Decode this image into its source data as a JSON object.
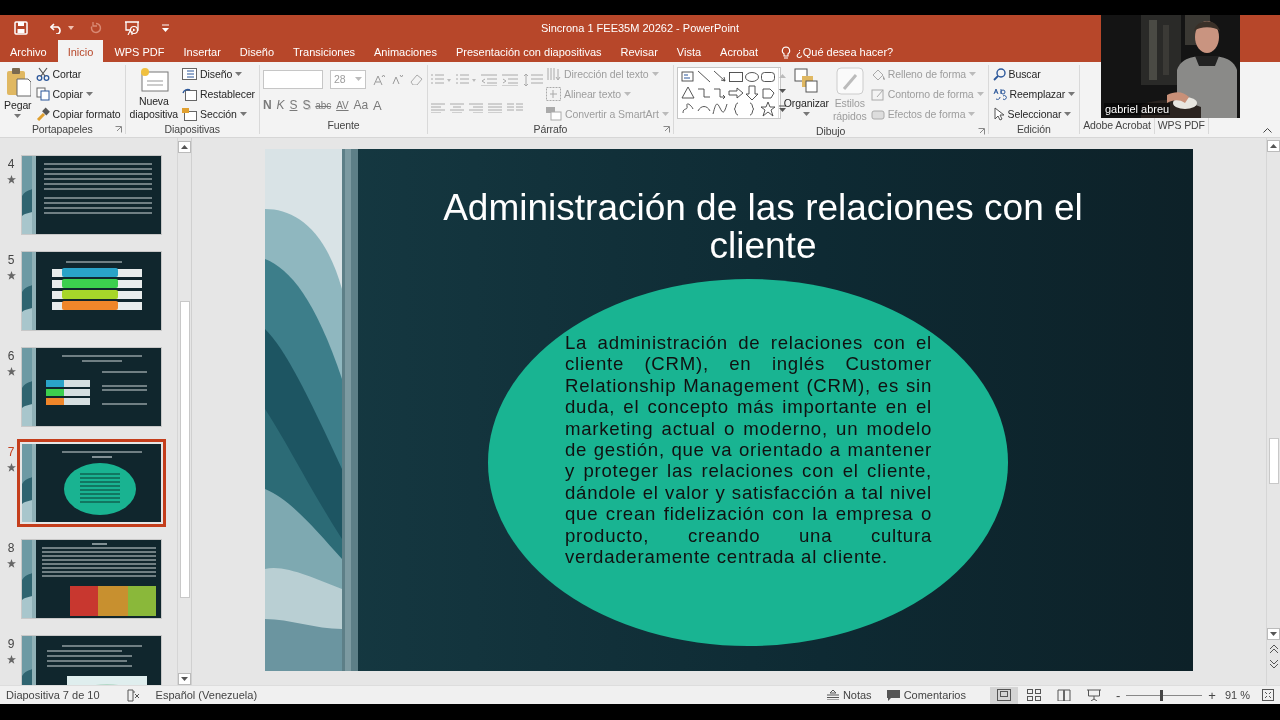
{
  "window": {
    "title": "Sincrona 1 FEE35M 20262 - PowerPoint"
  },
  "tabs": [
    {
      "label": "Archivo",
      "selected": false
    },
    {
      "label": "Inicio",
      "selected": true
    },
    {
      "label": "WPS PDF",
      "selected": false
    },
    {
      "label": "Insertar",
      "selected": false
    },
    {
      "label": "Diseño",
      "selected": false
    },
    {
      "label": "Transiciones",
      "selected": false
    },
    {
      "label": "Animaciones",
      "selected": false
    },
    {
      "label": "Presentación con diapositivas",
      "selected": false
    },
    {
      "label": "Revisar",
      "selected": false
    },
    {
      "label": "Vista",
      "selected": false
    },
    {
      "label": "Acrobat",
      "selected": false
    }
  ],
  "tell_me": "¿Qué desea hacer?",
  "ribbon": {
    "groups": [
      {
        "kind": "clipboard",
        "label": "Portapapeles",
        "items": [
          {
            "label": "Pegar"
          },
          {
            "label": "Cortar"
          },
          {
            "label": "Copiar"
          },
          {
            "label": "Copiar formato"
          }
        ]
      },
      {
        "kind": "slides",
        "label": "Diapositivas",
        "items": [
          {
            "label": "Nueva diapositiva"
          },
          {
            "label": "Diseño"
          },
          {
            "label": "Restablecer"
          },
          {
            "label": "Sección"
          }
        ]
      },
      {
        "kind": "font",
        "label": "Fuente",
        "font_size": "28",
        "format_buttons": [
          {
            "kind": "bold",
            "label": "N"
          },
          {
            "kind": "italic",
            "label": "K"
          },
          {
            "kind": "underline",
            "label": "S"
          },
          {
            "kind": "shadow",
            "label": "S"
          },
          {
            "kind": "strike",
            "label": "abc"
          },
          {
            "kind": "spacing",
            "label": "AV"
          },
          {
            "kind": "case",
            "label": "Aa"
          },
          {
            "kind": "color",
            "label": "A"
          }
        ]
      },
      {
        "kind": "paragraph",
        "label": "Párrafo",
        "items": [
          {
            "label": "Dirección del texto",
            "disabled": true
          },
          {
            "label": "Alinear texto",
            "disabled": true
          },
          {
            "label": "Convertir a SmartArt",
            "disabled": true
          }
        ]
      },
      {
        "kind": "drawing",
        "label": "Dibujo",
        "items": [
          {
            "label": "Organizar",
            "disabled": false
          },
          {
            "label": "Estilos rápidos",
            "disabled": true
          },
          {
            "label": "Relleno de forma",
            "disabled": true
          },
          {
            "label": "Contorno de forma",
            "disabled": true
          },
          {
            "label": "Efectos de forma",
            "disabled": true
          }
        ]
      },
      {
        "kind": "editing",
        "label": "Edición",
        "items": [
          {
            "label": "Buscar"
          },
          {
            "label": "Reemplazar"
          },
          {
            "label": "Seleccionar"
          }
        ]
      },
      {
        "kind": "plain",
        "label": "Adobe Acrobat"
      },
      {
        "kind": "plain",
        "label": "WPS PDF"
      }
    ]
  },
  "slide_panel": {
    "thumbnails": [
      {
        "number": "4",
        "selected": false
      },
      {
        "number": "5",
        "selected": false
      },
      {
        "number": "6",
        "selected": false
      },
      {
        "number": "7",
        "selected": true
      },
      {
        "number": "8",
        "selected": false
      },
      {
        "number": "9",
        "selected": false
      }
    ]
  },
  "slide": {
    "title": "Administración de las relaciones con el cliente",
    "body": "La administración de relaciones con el cliente (CRM), en inglés Customer Relationship Management (CRM), es sin duda, el concepto más importante en el marketing actual o moderno, un modelo de gestión, que va orientado a mantener y proteger las relaciones con el cliente, dándole el valor y satisfacción a tal nivel que crean fidelización con la empresa o producto, creando una cultura verdaderamente centrada al cliente."
  },
  "webcam": {
    "name": "gabriel abreu"
  },
  "status_bar": {
    "slide_info": "Diapositiva 7 de 10",
    "language": "Español (Venezuela)",
    "notes": "Notas",
    "comments": "Comentarios",
    "views": [
      {
        "kind": "normal",
        "selected": true
      },
      {
        "kind": "sorter",
        "selected": false
      },
      {
        "kind": "reading",
        "selected": false
      },
      {
        "kind": "slideshow",
        "selected": false
      }
    ],
    "zoom": {
      "out": "-",
      "in": "+",
      "level": 0.45,
      "reading": "91 %"
    }
  }
}
